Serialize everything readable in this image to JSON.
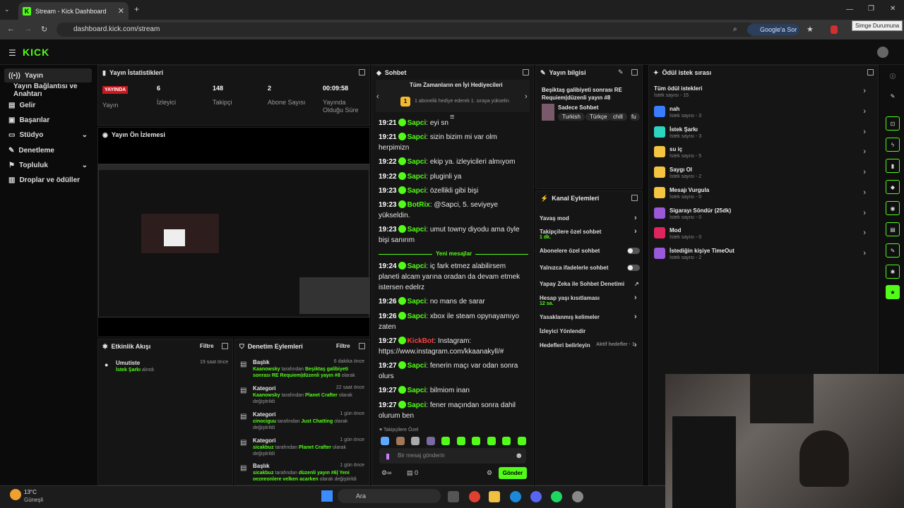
{
  "browser": {
    "tab_title": "Stream - Kick Dashboard",
    "url": "dashboard.kick.com/stream",
    "google_btn": "Google'a Sor",
    "tooltip": "Simge Durumuna"
  },
  "logo": "KICK",
  "nav": [
    "Yayın",
    "Yayın Bağlantısı ve Anahtarı",
    "Gelir",
    "Başarılar",
    "Stüdyo",
    "Denetleme",
    "Topluluk",
    "Droplar ve ödüller"
  ],
  "stats": {
    "title": "Yayın İstatistikleri",
    "live": "YAYINDA",
    "live_label": "Yayın",
    "items": [
      {
        "v": "6",
        "l": "İzleyici"
      },
      {
        "v": "148",
        "l": "Takipçi"
      },
      {
        "v": "2",
        "l": "Abone Sayısı"
      },
      {
        "v": "00:09:58",
        "l": "Yayında Olduğu Süre"
      }
    ]
  },
  "preview": {
    "title": "Yayın Ön İzlemesi"
  },
  "activity": {
    "title": "Etkinlik Akışı",
    "filter": "Filtre",
    "user": "Umutiste",
    "time": "19 saat önce",
    "reward": "İstek Şarkı",
    "suffix": "alındı"
  },
  "mod": {
    "title": "Denetim Eylemleri",
    "filter": "Filtre",
    "items": [
      {
        "t": "Başlık",
        "time": "6 dakika önce",
        "u": "Kaanowsky",
        "mid": "tarafından",
        "val": "Beşiktaş galibiyeti sonrası RE Requiem|düzenli yayın #8",
        "end": "olarak değiştirildi"
      },
      {
        "t": "Kategori",
        "time": "22 saat önce",
        "u": "Kaanowsky",
        "mid": "tarafından",
        "val": "Planet Crafter",
        "end": "olarak değiştirildi"
      },
      {
        "t": "Kategori",
        "time": "1 gün önce",
        "u": "cinociguu",
        "mid": "tarafından",
        "val": "Just Chatting",
        "end": "olarak değiştirildi"
      },
      {
        "t": "Kategori",
        "time": "1 gün önce",
        "u": "sicakbuz",
        "mid": "tarafından",
        "val": "Planet Crafter",
        "end": "olarak değiştirildi"
      },
      {
        "t": "Başlık",
        "time": "1 gün önce",
        "u": "sicakbuz",
        "mid": "tarafından",
        "val": "düzenli yayın #6| Yeni oezeeonlere velken acarken",
        "end": "olarak değiştirildi"
      }
    ]
  },
  "chat": {
    "title": "Sohbet",
    "gifters_title": "Tüm Zamanların en İyi Hediyecileri",
    "gifters_sub": "1 abonelik hediye ederek 1. sıraya yükselin",
    "gifters_rank": "1",
    "new_msgs": "Yeni mesajlar",
    "follower_only": "Takipçilere Özel",
    "placeholder": "Bir mesaj gönderin",
    "send": "Gönder",
    "count": "0",
    "lines": [
      {
        "ts": "19:21",
        "u": "Sapci",
        "m": "eyi sn"
      },
      {
        "ts": "19:21",
        "u": "Sapci",
        "m": "sizin bizim mi var olm herpimizn"
      },
      {
        "ts": "19:22",
        "u": "Sapci",
        "m": "ekip ya. izleyicileri almıyom"
      },
      {
        "ts": "19:22",
        "u": "Sapci",
        "m": "pluginli ya"
      },
      {
        "ts": "19:23",
        "u": "Sapci",
        "m": "özellikli gibi bişi"
      },
      {
        "ts": "19:23",
        "u": "BotRix",
        "m": "@Sapci, 5. seviyeye yükseldin."
      },
      {
        "ts": "19:23",
        "u": "Sapci",
        "m": "umut towny diyodu ama öyle bişi sanırım"
      },
      {
        "ts": "19:24",
        "u": "Sapci",
        "m": "iç fark etmez alabilirsem planeti alcam yarına oradan da devam etmek istersen edelrz"
      },
      {
        "ts": "19:26",
        "u": "Sapci",
        "m": "no mans de sarar"
      },
      {
        "ts": "19:26",
        "u": "Sapci",
        "m": "xbox ile steam opynayamıyo zaten"
      },
      {
        "ts": "19:27",
        "u": "KickBot",
        "m": "Instagram: https://www.instagram.com/kkaanakyll/#"
      },
      {
        "ts": "19:27",
        "u": "Sapci",
        "m": "fenerin maçı var odan sonra olurs"
      },
      {
        "ts": "19:27",
        "u": "Sapci",
        "m": "bilmiom inan"
      },
      {
        "ts": "19:27",
        "u": "Sapci",
        "m": "fener maçından sonra dahil olurum ben"
      }
    ]
  },
  "info": {
    "title": "Yayın bilgisi",
    "stream_title": "Beşiktaş galibiyeti sonrası RE Requiem|düzenli yayın #8",
    "category": "Sadece Sohbet",
    "tags": [
      "Turkish",
      "Türkçe",
      "chill",
      "fu"
    ]
  },
  "actions": {
    "title": "Kanal Eylemleri",
    "items": [
      {
        "l": "Yavaş mod",
        "s": "",
        "kind": "chev"
      },
      {
        "l": "Takipçilere özel sohbet",
        "s": "1 dk.",
        "kind": "chev"
      },
      {
        "l": "Abonelere özel sohbet",
        "s": "",
        "kind": "toggle"
      },
      {
        "l": "Yalnızca ifadelerle sohbet",
        "s": "",
        "kind": "toggle"
      },
      {
        "l": "Yapay Zeka ile Sohbet Denetimi",
        "s": "",
        "kind": "ext"
      },
      {
        "l": "Hesap yaşı kısıtlaması",
        "s": "12 sa.",
        "kind": "chev"
      },
      {
        "l": "Yasaklanmış kelimeler",
        "s": "",
        "kind": "chev"
      },
      {
        "l": "İzleyici Yönlendir",
        "s": "",
        "kind": "none"
      },
      {
        "l": "Hedefleri belirleyin",
        "s": "Aktif hedefler · 1",
        "kind": "chev"
      }
    ]
  },
  "rewards": {
    "title": "Ödül istek sırası",
    "all": "Tüm ödül istekleri",
    "all_sub": "İstek sayısı - 15",
    "items": [
      {
        "t": "nah",
        "s": "İstek sayısı - 3",
        "c": "#3b7bff"
      },
      {
        "t": "İstek Şarkı",
        "s": "İstek sayısı - 3",
        "c": "#2dd4bf"
      },
      {
        "t": "su iç",
        "s": "İstek sayısı - 5",
        "c": "#f5c542"
      },
      {
        "t": "Saygı Ol",
        "s": "İstek sayısı - 2",
        "c": "#f5c542"
      },
      {
        "t": "Mesajı Vurgula",
        "s": "İstek sayısı - 0",
        "c": "#f5c542"
      },
      {
        "t": "Sigarayı Söndür (25dk)",
        "s": "İstek sayısı - 0",
        "c": "#9b59d9"
      },
      {
        "t": "Mod",
        "s": "İstek sayısı - 0",
        "c": "#e0245e"
      },
      {
        "t": "İstediğin kişiye TimeOut",
        "s": "İstek sayısı - 2",
        "c": "#9b59d9"
      }
    ]
  },
  "taskbar": {
    "temp": "13°C",
    "weather": "Güneşli",
    "search": "Ara"
  }
}
